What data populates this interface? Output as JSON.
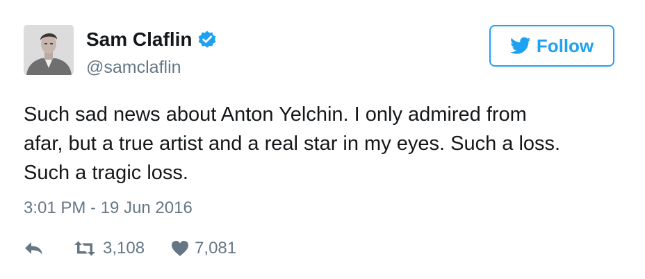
{
  "author": {
    "name": "Sam Claflin",
    "handle": "@samclaflin",
    "verified": true
  },
  "follow_button": {
    "label": "Follow",
    "icon": "twitter-bird-icon"
  },
  "tweet": {
    "lines": [
      "Such sad news about Anton Yelchin. I only admired from",
      "afar, but a true artist and a real star in my eyes. Such a loss.",
      "Such a tragic loss."
    ],
    "timestamp": "3:01 PM - 19 Jun 2016"
  },
  "actions": {
    "reply_icon": "reply-icon",
    "retweet_icon": "retweet-icon",
    "retweet_count": "3,108",
    "like_icon": "heart-icon",
    "like_count": "7,081"
  },
  "colors": {
    "accent": "#1da1f2",
    "text": "#14171a",
    "secondary": "#657786",
    "verified": "#1da1f2"
  }
}
